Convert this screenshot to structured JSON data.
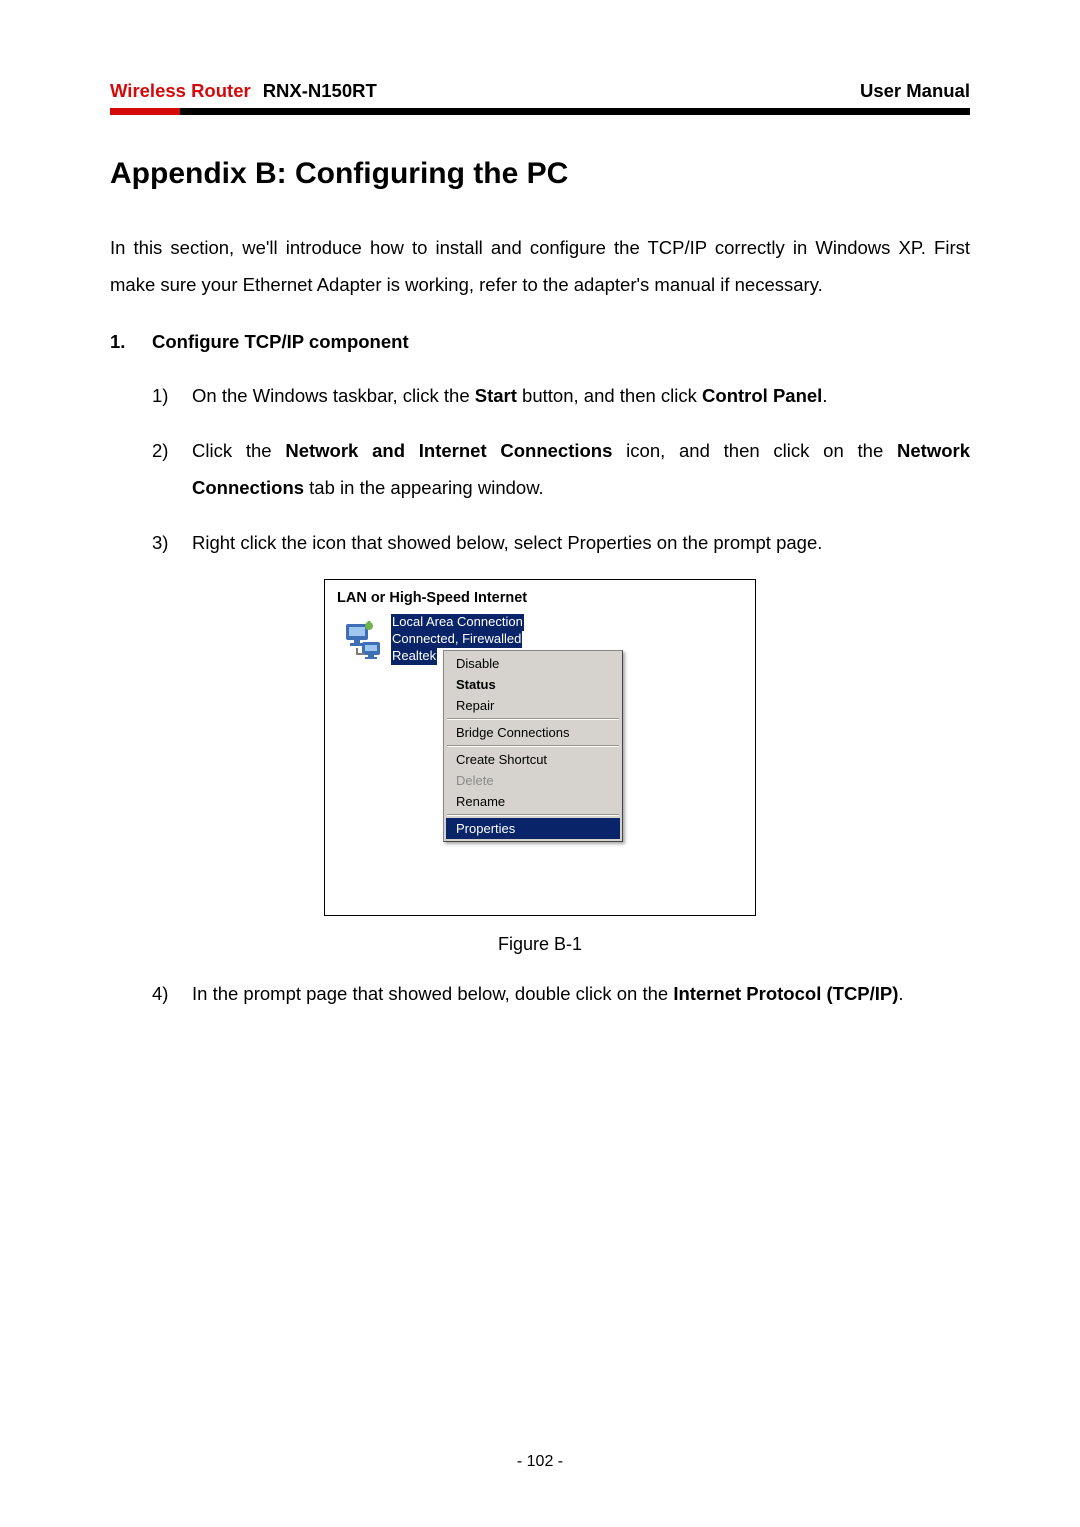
{
  "header": {
    "product_label": "Wireless Router",
    "model": "RNX-N150RT",
    "doc_type": "User Manual"
  },
  "title": "Appendix B: Configuring the PC",
  "intro": "In this section, we'll introduce how to install and configure the TCP/IP correctly in Windows XP. First make sure your Ethernet Adapter is working, refer to the adapter's manual if necessary.",
  "section": {
    "number": "1.",
    "title": "Configure TCP/IP component"
  },
  "steps": {
    "s1": {
      "num": "1)",
      "pre": "On the Windows taskbar, click the ",
      "b1": "Start",
      "mid": " button, and then click ",
      "b2": "Control Panel",
      "post": "."
    },
    "s2": {
      "num": "2)",
      "pre": "Click the ",
      "b1": "Network and Internet Connections",
      "mid": " icon, and then click on the ",
      "b2": "Network Connections",
      "post": " tab in the appearing window."
    },
    "s3": {
      "num": "3)",
      "text": "Right click the icon that showed below, select Properties on the prompt page."
    },
    "s4": {
      "num": "4)",
      "pre": "In the prompt page that showed below, double click on the ",
      "b1": "Internet Protocol (TCP/IP)",
      "post": "."
    }
  },
  "figure": {
    "caption": "Figure B-1",
    "category_title": "LAN or High-Speed Internet",
    "connection": {
      "name": "Local Area Connection",
      "status": "Connected, Firewalled",
      "adapter": "Realtek"
    },
    "menu": {
      "disable": "Disable",
      "status": "Status",
      "repair": "Repair",
      "bridge": "Bridge Connections",
      "shortcut": "Create Shortcut",
      "delete": "Delete",
      "rename": "Rename",
      "properties": "Properties"
    }
  },
  "page_number": "- 102 -"
}
